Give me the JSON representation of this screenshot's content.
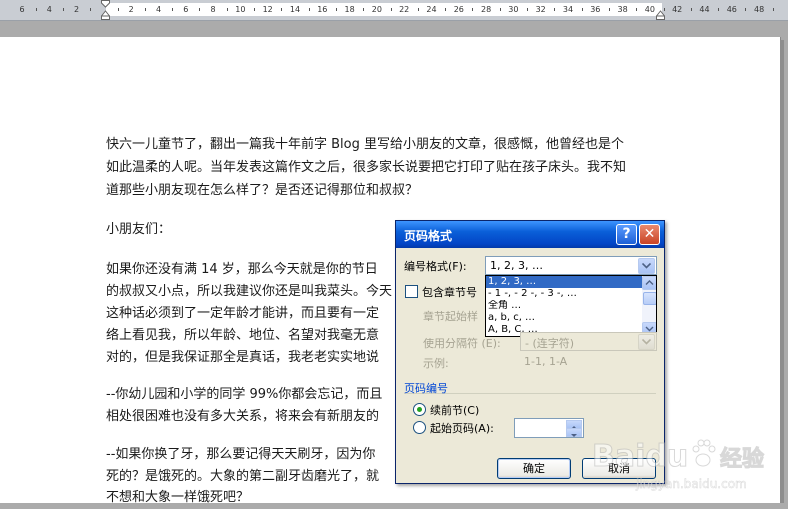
{
  "ruler": {
    "labels": [
      "6",
      "4",
      "2",
      "",
      "2",
      "4",
      "6",
      "8",
      "10",
      "12",
      "14",
      "16",
      "18",
      "20",
      "22",
      "24",
      "26",
      "28",
      "30",
      "32",
      "34",
      "36",
      "38",
      "40",
      "42",
      "44",
      "46",
      "48"
    ]
  },
  "document": {
    "lines": [
      "快六一儿童节了，翻出一篇我十年前字 Blog 里写给小朋友的文章，很感慨，他曾经也是个",
      "如此温柔的人呢。当年发表这篇作文之后，很多家长说要把它打印了贴在孩子床头。我不知",
      "道那些小朋友现在怎么样了？是否还记得那位和叔叔？",
      "小朋友们：",
      "如果你还没有满 14 岁，那么今天就是你的节日",
      "的叔叔又小点，所以我建议你还是叫我菜头。今天",
      "这种话必须到了一定年龄才能讲，而且要有一定",
      "络上看见我，所以年龄、地位、名望对我毫无意",
      "对的，但是我保证那全是真话，我老老实实地说",
      "--你幼儿园和小学的同学 99%你都会忘记，而且",
      "相处很困难也没有多大关系，将来会有新朋友的",
      "--如果你换了牙，那么要记得天天刷牙，因为你",
      "死的？是饿死的。大象的第二副牙齿磨光了，就",
      "不想和大象一样饿死吧？"
    ]
  },
  "dialog": {
    "title": "页码格式",
    "help_glyph": "?",
    "close_glyph": "✕",
    "number_format_label": "编号格式(F):",
    "number_format_value": "1, 2, 3, …",
    "dropdown_options": [
      "1, 2, 3, …",
      "- 1 -, - 2 -, - 3 -, …",
      "全角 …",
      "a, b, c, …",
      "A, B, C, …"
    ],
    "include_chapter_label": "包含章节号",
    "chapter_style_label": "章节起始样",
    "separator_label": "使用分隔符 (E):",
    "separator_value": "-  (连字符)",
    "example_label": "示例:",
    "example_value": "1-1, 1-A",
    "group_title": "页码编号",
    "continue_label": "续前节(C)",
    "start_at_label": "起始页码(A):",
    "start_at_value": "",
    "ok_label": "确定",
    "cancel_label": "取消"
  },
  "watermark": {
    "brand": "Baidu",
    "sub": "经验",
    "url": "jingyan.baidu.com"
  },
  "colors": {
    "title_bar": "#0a5fd8",
    "selection": "#316ac5",
    "dialog_bg": "#ece9d8"
  }
}
